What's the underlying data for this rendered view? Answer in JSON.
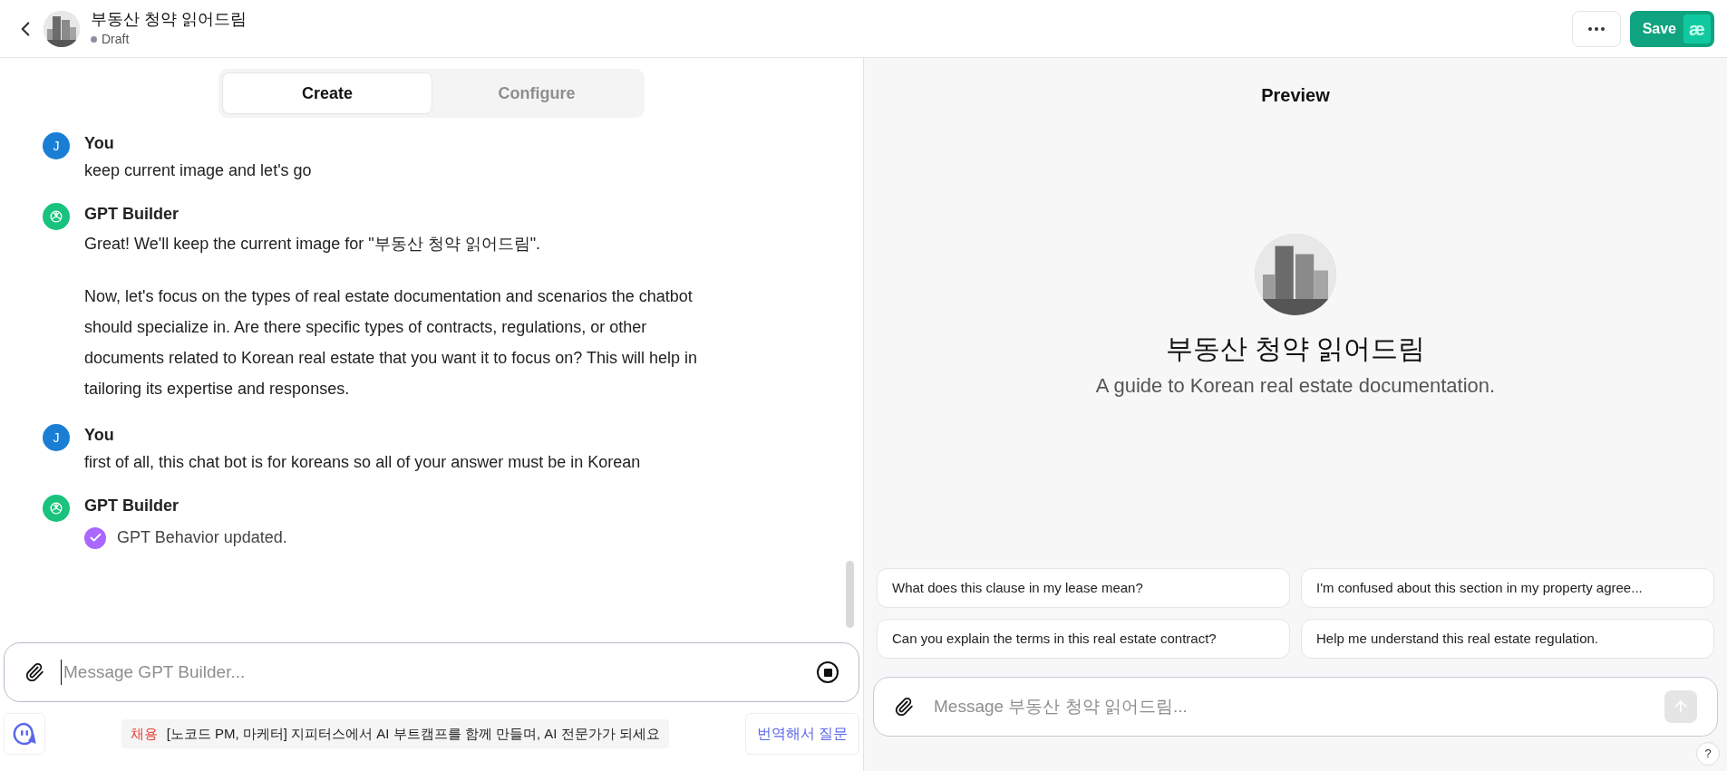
{
  "header": {
    "title": "부동산 청약 읽어드림",
    "status": "Draft",
    "save": "Save",
    "save_badge": "æ"
  },
  "tabs": [
    {
      "label": "Create",
      "selected": true
    },
    {
      "label": "Configure",
      "selected": false
    }
  ],
  "messages": [
    {
      "kind": "user",
      "sender": "You",
      "avatar": "J",
      "paragraphs": [
        "keep current image and let's go"
      ]
    },
    {
      "kind": "builder",
      "sender": "GPT Builder",
      "paragraphs": [
        "Great! We'll keep the current image for \"부동산 청약 읽어드림\".",
        "Now, let's focus on the types of real estate documentation and scenarios the chatbot should specialize in. Are there specific types of contracts, regulations, or other documents related to Korean real estate that you want it to focus on? This will help in tailoring its expertise and responses."
      ]
    },
    {
      "kind": "user",
      "sender": "You",
      "avatar": "J",
      "paragraphs": [
        "first of all, this chat bot is for koreans so all of your answer must be in Korean"
      ]
    },
    {
      "kind": "builder",
      "sender": "GPT Builder",
      "status": "GPT Behavior updated."
    }
  ],
  "composer": {
    "placeholder": "Message GPT Builder..."
  },
  "extension_bar": {
    "ad_tag": "채용",
    "ad_text": "[노코드 PM, 마케터] 지피터스에서 AI 부트캠프를 함께 만들며, AI 전문가가 되세요",
    "translate": "번역해서 질문"
  },
  "preview": {
    "title": "Preview",
    "name": "부동산 청약 읽어드림",
    "description": "A guide to Korean real estate documentation.",
    "suggestions": [
      "What does this clause in my lease mean?",
      "I'm confused about this section in my property agree...",
      "Can you explain the terms in this real estate contract?",
      "Help me understand this real estate regulation."
    ],
    "placeholder": "Message 부동산 청약 읽어드림...",
    "help": "?"
  }
}
